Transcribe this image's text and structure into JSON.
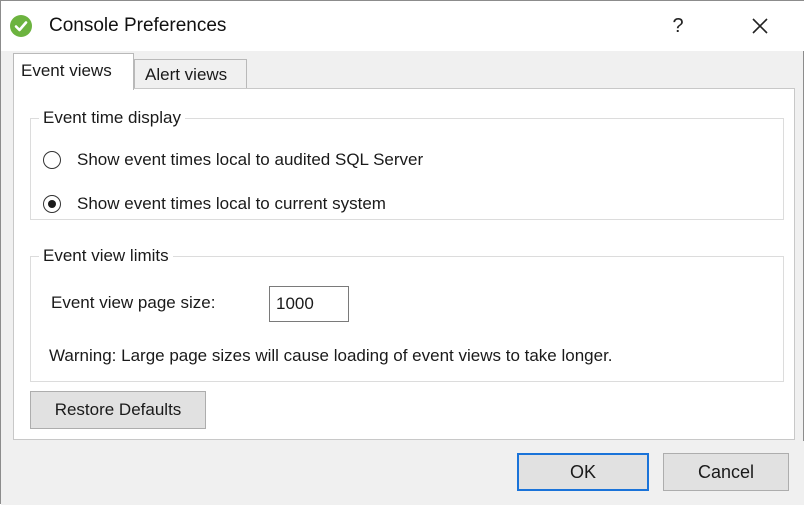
{
  "window": {
    "title": "Console Preferences",
    "help_label": "?",
    "icon": "green-check-icon",
    "close_icon": "close-icon"
  },
  "tabs": [
    {
      "label": "Event views",
      "active": true
    },
    {
      "label": "Alert views",
      "active": false
    }
  ],
  "event_time_display": {
    "legend": "Event time display",
    "options": [
      {
        "label": "Show event times local to audited SQL Server",
        "selected": false
      },
      {
        "label": "Show event times local to current system",
        "selected": true
      }
    ]
  },
  "event_view_limits": {
    "legend": "Event view limits",
    "page_size_label": "Event view page size:",
    "page_size_value": "1000",
    "warning": "Warning: Large page sizes will cause loading of event views to take  longer."
  },
  "buttons": {
    "restore_defaults": "Restore Defaults",
    "ok": "OK",
    "cancel": "Cancel"
  },
  "colors": {
    "accent": "#1a73d9",
    "app_icon": "#6cb33f"
  }
}
